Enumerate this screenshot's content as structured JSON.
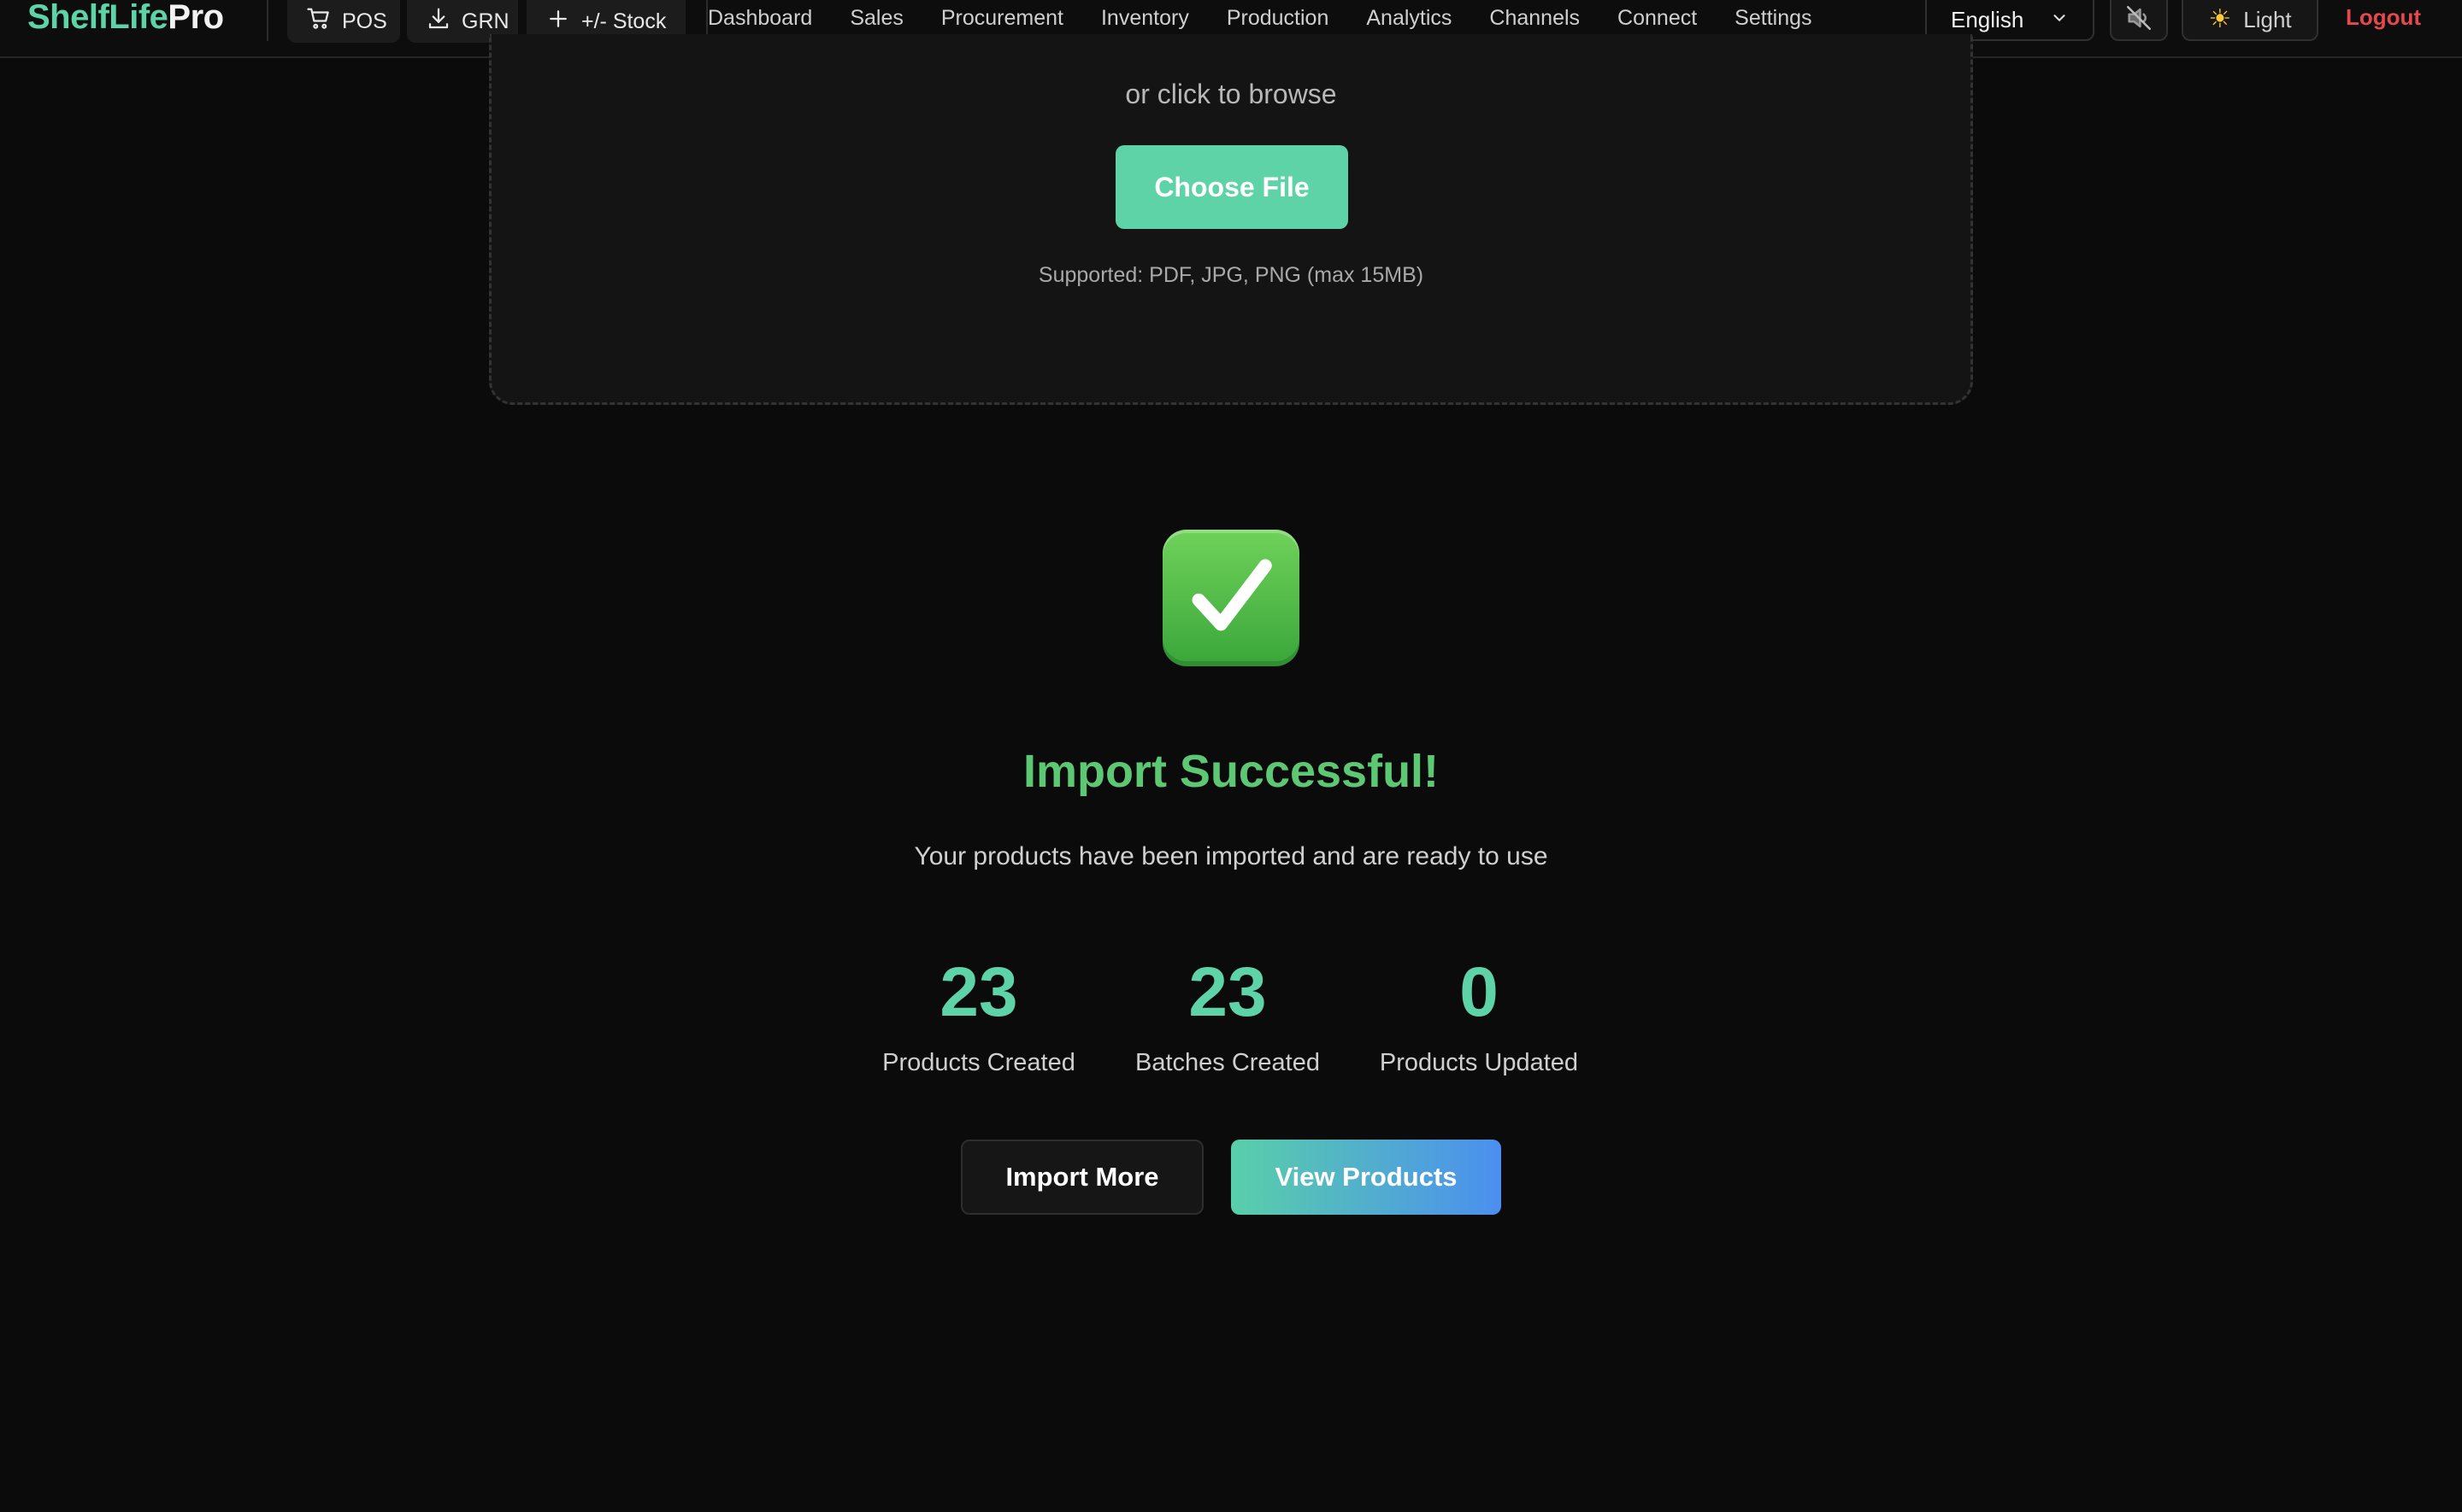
{
  "brand": {
    "part1": "ShelfLife",
    "part2": "Pro",
    "accent_color": "#5fd3a8"
  },
  "quick_actions": [
    {
      "label": "POS",
      "icon": "cart-icon"
    },
    {
      "label": "GRN",
      "icon": "download-icon"
    },
    {
      "label": "+/- Stock",
      "icon": "plus-icon"
    }
  ],
  "nav": {
    "items": [
      "Dashboard",
      "Sales",
      "Procurement",
      "Inventory",
      "Production",
      "Analytics",
      "Channels",
      "Connect",
      "Settings"
    ]
  },
  "header_controls": {
    "language": "English",
    "sound_icon": "speaker-muted-icon",
    "theme_label": "Light",
    "theme_icon": "sun-icon",
    "logout_label": "Logout",
    "logout_color": "#e5484d"
  },
  "upload": {
    "browse_text": "or click to browse",
    "choose_file_label": "Choose File",
    "supported_text": "Supported: PDF, JPG, PNG (max 15MB)"
  },
  "result": {
    "icon": "check-box-icon",
    "title": "Import Successful!",
    "subtitle": "Your products have been imported and are ready to use",
    "title_color": "#5cc873",
    "stats": [
      {
        "value": "23",
        "label": "Products Created"
      },
      {
        "value": "23",
        "label": "Batches Created"
      },
      {
        "value": "0",
        "label": "Products Updated"
      }
    ],
    "import_more_label": "Import More",
    "view_products_label": "View Products"
  }
}
